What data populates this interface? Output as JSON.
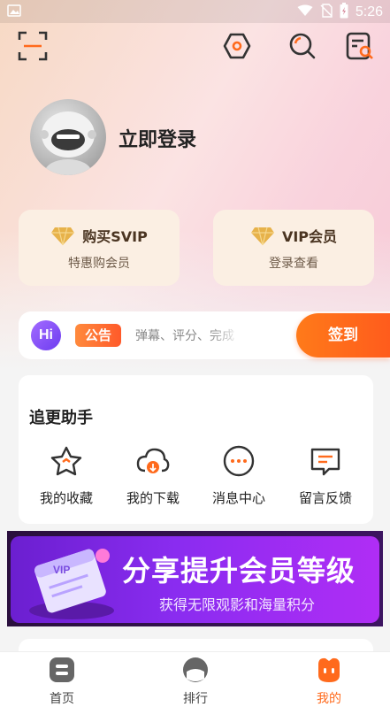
{
  "status_bar": {
    "time": "5:26"
  },
  "profile": {
    "login_label": "立即登录"
  },
  "vip_cards": [
    {
      "title": "购买SVIP",
      "subtitle": "特惠购会员"
    },
    {
      "title": "VIP会员",
      "subtitle": "登录查看"
    }
  ],
  "notice": {
    "hi_label": "Hi",
    "badge": "公告",
    "text": "弹幕、评分、完成",
    "checkin_label": "签到"
  },
  "helper": {
    "title": "追更助手",
    "items": [
      {
        "label": "我的收藏",
        "icon": "star-icon"
      },
      {
        "label": "我的下载",
        "icon": "download-cloud-icon"
      },
      {
        "label": "消息中心",
        "icon": "message-icon"
      },
      {
        "label": "留言反馈",
        "icon": "feedback-icon"
      }
    ]
  },
  "banner": {
    "headline": "分享提升会员等级",
    "subline": "获得无限观影和海量积分",
    "ticket_label": "VIP"
  },
  "tabbar": {
    "items": [
      {
        "label": "首页",
        "icon": "home-icon",
        "active": false
      },
      {
        "label": "排行",
        "icon": "rank-icon",
        "active": false
      },
      {
        "label": "我的",
        "icon": "mine-icon",
        "active": true
      }
    ]
  },
  "colors": {
    "accent": "#ff6a1c",
    "vip_gold": "#e7b24a",
    "banner_purple": "#8a2cf0"
  }
}
